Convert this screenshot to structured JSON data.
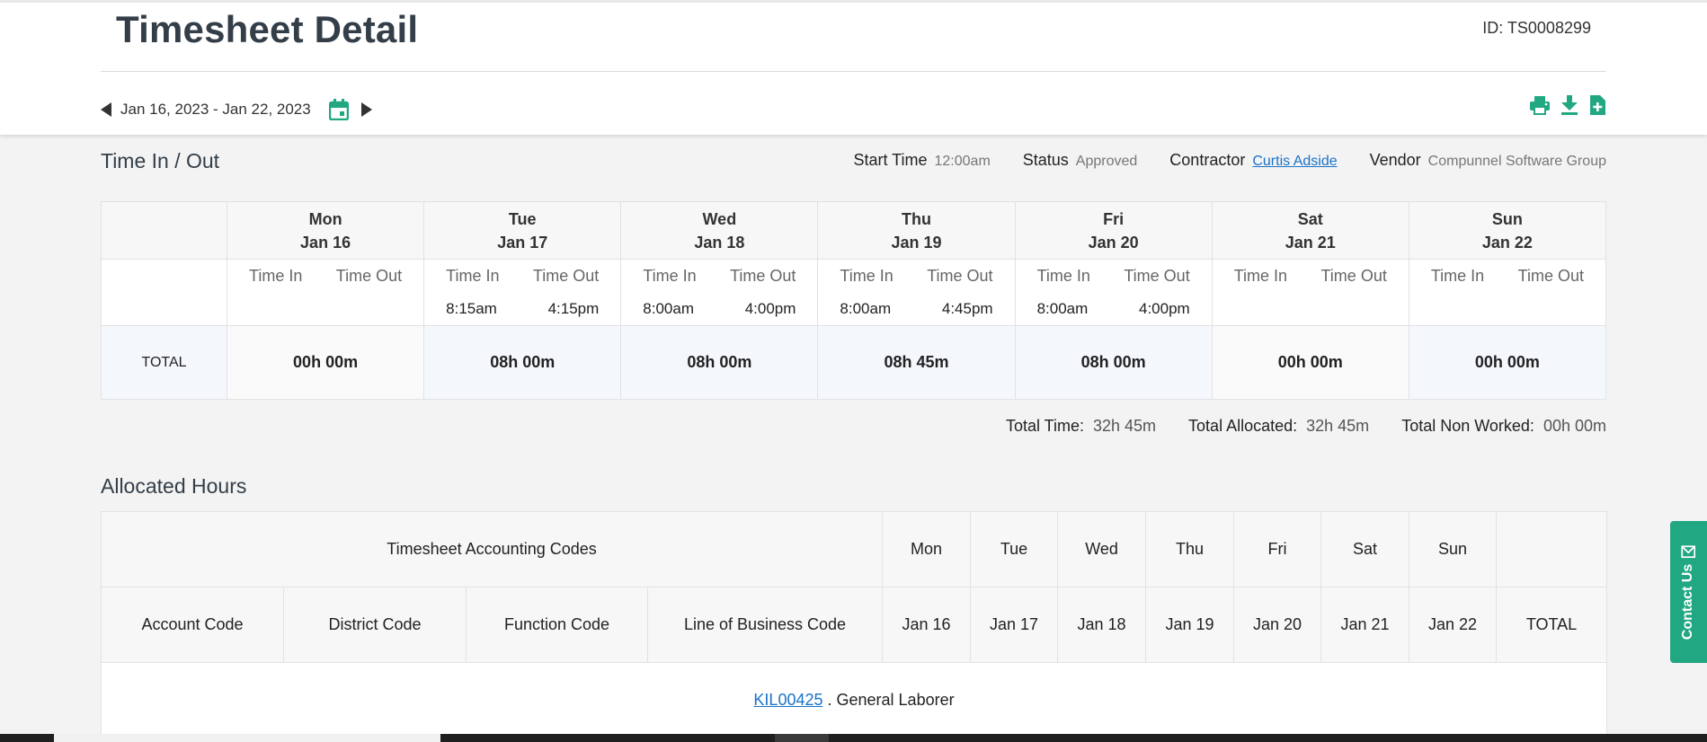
{
  "page": {
    "title": "Timesheet Detail",
    "id_text": "ID: TS0008299"
  },
  "date_range": "Jan 16, 2023 - Jan 22, 2023",
  "colors": {
    "accent": "#22a783",
    "link": "#1a73c8"
  },
  "icons": [
    "previous-week-icon",
    "calendar-icon",
    "next-week-icon",
    "print-icon",
    "download-icon",
    "add-document-icon",
    "mail-icon"
  ],
  "time_in_out": {
    "section_title": "Time In / Out",
    "start_time_label": "Start Time",
    "start_time": "12:00am",
    "status_label": "Status",
    "status": "Approved",
    "contractor_label": "Contractor",
    "contractor": "Curtis Adside",
    "vendor_label": "Vendor",
    "vendor": "Compunnel Software Group",
    "time_in_label": "Time In",
    "time_out_label": "Time Out",
    "total_label": "TOTAL",
    "days": [
      {
        "day": "Mon",
        "date": "Jan 16",
        "time_in": "",
        "time_out": "",
        "total": "00h 00m"
      },
      {
        "day": "Tue",
        "date": "Jan 17",
        "time_in": "8:15am",
        "time_out": "4:15pm",
        "total": "08h 00m"
      },
      {
        "day": "Wed",
        "date": "Jan 18",
        "time_in": "8:00am",
        "time_out": "4:00pm",
        "total": "08h 00m"
      },
      {
        "day": "Thu",
        "date": "Jan 19",
        "time_in": "8:00am",
        "time_out": "4:45pm",
        "total": "08h 45m"
      },
      {
        "day": "Fri",
        "date": "Jan 20",
        "time_in": "8:00am",
        "time_out": "4:00pm",
        "total": "08h 00m"
      },
      {
        "day": "Sat",
        "date": "Jan 21",
        "time_in": "",
        "time_out": "",
        "total": "00h 00m"
      },
      {
        "day": "Sun",
        "date": "Jan 22",
        "time_in": "",
        "time_out": "",
        "total": "00h 00m"
      }
    ]
  },
  "totals": {
    "total_time_label": "Total Time:",
    "total_time": "32h 45m",
    "total_allocated_label": "Total Allocated:",
    "total_allocated": "32h 45m",
    "total_non_worked_label": "Total Non Worked:",
    "total_non_worked": "00h 00m"
  },
  "allocated": {
    "section_title": "Allocated Hours",
    "group_header": "Timesheet Accounting Codes",
    "code_headers": [
      "Account Code",
      "District Code",
      "Function Code",
      "Line of Business Code"
    ],
    "day_names": [
      "Mon",
      "Tue",
      "Wed",
      "Thu",
      "Fri",
      "Sat",
      "Sun"
    ],
    "day_dates": [
      "Jan 16",
      "Jan 17",
      "Jan 18",
      "Jan 19",
      "Jan 20",
      "Jan 21",
      "Jan 22"
    ],
    "total_header": "TOTAL",
    "row_code_link": "KIL00425",
    "row_code_desc": " . General Laborer"
  },
  "contact_us": "Contact Us"
}
